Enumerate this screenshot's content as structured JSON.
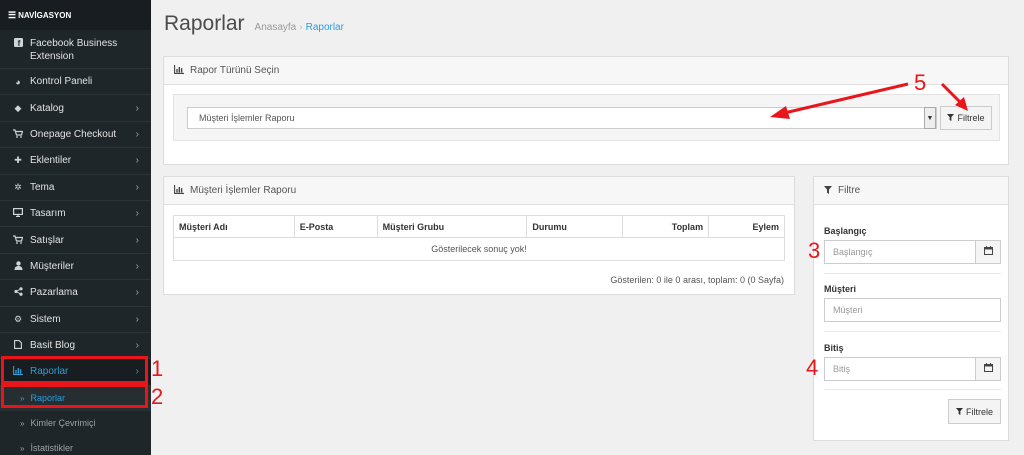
{
  "sidebar": {
    "title": "NAVİGASYON",
    "items": [
      {
        "label": "Facebook Business Extension",
        "icon": "facebook-square-icon",
        "chevron": false
      },
      {
        "label": "Kontrol Paneli",
        "icon": "dashboard-icon",
        "chevron": false
      },
      {
        "label": "Katalog",
        "icon": "tag-icon",
        "chevron": true
      },
      {
        "label": "Onepage Checkout",
        "icon": "cart-icon",
        "chevron": true
      },
      {
        "label": "Eklentiler",
        "icon": "puzzle-icon",
        "chevron": true
      },
      {
        "label": "Tema",
        "icon": "cogs-icon",
        "chevron": true
      },
      {
        "label": "Tasarım",
        "icon": "desktop-icon",
        "chevron": true
      },
      {
        "label": "Satışlar",
        "icon": "cart-icon",
        "chevron": true
      },
      {
        "label": "Müşteriler",
        "icon": "user-icon",
        "chevron": true
      },
      {
        "label": "Pazarlama",
        "icon": "share-icon",
        "chevron": true
      },
      {
        "label": "Sistem",
        "icon": "gear-icon",
        "chevron": true
      },
      {
        "label": "Basit Blog",
        "icon": "file-icon",
        "chevron": true
      },
      {
        "label": "Raporlar",
        "icon": "bar-chart-icon",
        "chevron": true,
        "active": true
      }
    ],
    "sub_items": [
      {
        "label": "Raporlar",
        "active": true
      },
      {
        "label": "Kimler Çevrimiçi",
        "active": false
      },
      {
        "label": "İstatistikler",
        "active": false
      }
    ]
  },
  "header": {
    "title": "Raporlar",
    "breadcrumb": [
      "Anasayfa",
      "Raporlar"
    ]
  },
  "report_type_panel": {
    "heading": "Rapor Türünü Seçin",
    "selected_report": "Müşteri İşlemler Raporu",
    "filter_button": "Filtrele"
  },
  "result_panel": {
    "heading": "Müşteri İşlemler Raporu",
    "columns": [
      "Müşteri Adı",
      "E-Posta",
      "Müşteri Grubu",
      "Durumu",
      "Toplam",
      "Eylem"
    ],
    "empty_text": "Gösterilecek sonuç yok!",
    "pager_text": "Gösterilen: 0 ile 0 arası, toplam: 0 (0 Sayfa)"
  },
  "filter_panel": {
    "heading": "Filtre",
    "start_label": "Başlangıç",
    "start_placeholder": "Başlangıç",
    "customer_label": "Müşteri",
    "customer_placeholder": "Müşteri",
    "end_label": "Bitiş",
    "end_placeholder": "Bitiş",
    "filter_button": "Filtrele"
  },
  "annotations": [
    "1",
    "2",
    "3",
    "4",
    "5"
  ],
  "colors": {
    "accent": "#2d9ed8",
    "annotation": "#e8161b",
    "sidebar": "#1f2629"
  }
}
